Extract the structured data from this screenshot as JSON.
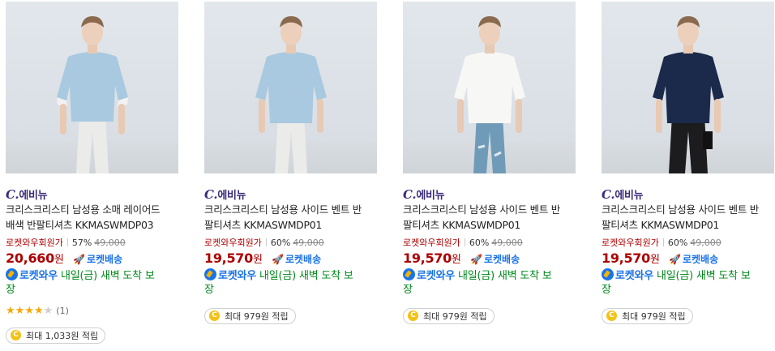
{
  "products": [
    {
      "brand_prefix": "C.",
      "brand": "에비뉴",
      "title_line1": "크리스크리스티 남성용 소매 레이어드",
      "title_line2": "배색 반팔티셔츠 KKMASWMDP03",
      "price_label": "로켓와우회원가",
      "discount": "57%",
      "original_price": "49,000",
      "price": "20,660",
      "currency": "원",
      "rocket_label": "로켓배송",
      "delivery_rocket": "로켓와우",
      "delivery_text": "내일(금) 새벽 도착 보",
      "delivery_text2": "장",
      "rating_count": "(1)",
      "reward": "최대 1,033원 적립",
      "shirt_color": "#a9c9e0",
      "sleeve_color": "#f2f2f2",
      "pants_color": "#ebebea"
    },
    {
      "brand_prefix": "C.",
      "brand": "에비뉴",
      "title_line1": "크리스크리스티 남성용 사이드 벤트 반",
      "title_line2": "팔티셔츠 KKMASWMDP01",
      "price_label": "로켓와우회원가",
      "discount": "60%",
      "original_price": "49,000",
      "price": "19,570",
      "currency": "원",
      "rocket_label": "로켓배송",
      "delivery_rocket": "로켓와우",
      "delivery_text": "내일(금) 새벽 도착 보",
      "delivery_text2": "장",
      "reward": "최대 979원 적립",
      "shirt_color": "#a9c9e0",
      "sleeve_color": "#a9c9e0",
      "pants_color": "#ebebea"
    },
    {
      "brand_prefix": "C.",
      "brand": "에비뉴",
      "title_line1": "크리스크리스티 남성용 사이드 벤트 반",
      "title_line2": "팔티셔츠 KKMASWMDP01",
      "price_label": "로켓와우회원가",
      "discount": "60%",
      "original_price": "49,000",
      "price": "19,570",
      "currency": "원",
      "rocket_label": "로켓배송",
      "delivery_rocket": "로켓와우",
      "delivery_text": "내일(금) 새벽 도착 보",
      "delivery_text2": "장",
      "reward": "최대 979원 적립",
      "shirt_color": "#f7f7f5",
      "sleeve_color": "#f7f7f5",
      "pants_color": "#6f9bb8"
    },
    {
      "brand_prefix": "C.",
      "brand": "에비뉴",
      "title_line1": "크리스크리스티 남성용 사이드 벤트 반",
      "title_line2": "팔티셔츠 KKMASWMDP01",
      "price_label": "로켓와우회원가",
      "discount": "60%",
      "original_price": "49,000",
      "price": "19,570",
      "currency": "원",
      "rocket_label": "로켓배송",
      "delivery_rocket": "로켓와우",
      "delivery_text": "내일(금) 새벽 도착 보",
      "delivery_text2": "장",
      "reward": "최대 979원 적립",
      "shirt_color": "#1b2a4a",
      "sleeve_color": "#1b2a4a",
      "pants_color": "#1c1c1f"
    }
  ],
  "product1_rating": 4
}
